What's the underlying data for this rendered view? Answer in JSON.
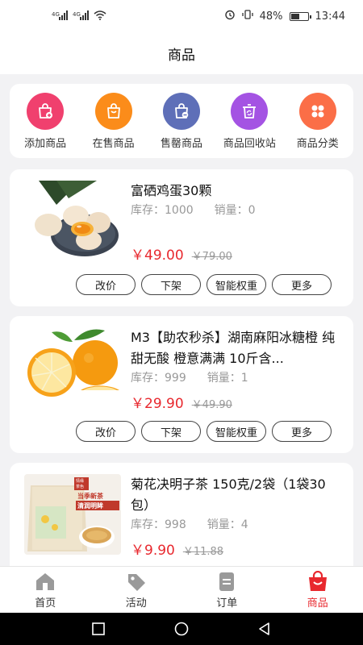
{
  "status_bar": {
    "signal1": "⁴ᴳ",
    "signal2": "⁴ᴳ",
    "battery_pct": "48%",
    "time": "13:44"
  },
  "header": {
    "title": "商品"
  },
  "categories": [
    {
      "label": "添加商品",
      "icon": "bag-plus-icon",
      "color": "#f0406e"
    },
    {
      "label": "在售商品",
      "icon": "bag-icon",
      "color": "#fb8c1a"
    },
    {
      "label": "售罄商品",
      "icon": "bag-soldout-icon",
      "color": "#5e6fb8"
    },
    {
      "label": "商品回收站",
      "icon": "recycle-icon",
      "color": "#a453e3"
    },
    {
      "label": "商品分类",
      "icon": "category-icon",
      "color": "#fb6e47"
    }
  ],
  "products": [
    {
      "title": "富硒鸡蛋30颗",
      "stock_label": "库存：1000",
      "sales_label": "销量：0",
      "price": "￥49.00",
      "old_price": "￥79.00",
      "image": "eggs-image"
    },
    {
      "title": "M3【助农秒杀】湖南麻阳冰糖橙 纯甜无酸 橙意满满 10斤含...",
      "stock_label": "库存：999",
      "sales_label": "销量：1",
      "price": "￥29.90",
      "old_price": "￥49.90",
      "image": "oranges-image"
    },
    {
      "title": "菊花决明子茶 150克/2袋（1袋30包）",
      "stock_label": "库存：998",
      "sales_label": "销量：4",
      "price": "￥9.90",
      "old_price": "￥11.88",
      "image": "tea-image",
      "image_text": [
        "情缘",
        "茶色",
        "当季新茶",
        "清润明眸"
      ]
    }
  ],
  "actions": {
    "reprice": "改价",
    "delist": "下架",
    "weight": "智能权重",
    "more": "更多"
  },
  "tabs": [
    {
      "label": "首页",
      "icon": "home-icon"
    },
    {
      "label": "活动",
      "icon": "tag-icon"
    },
    {
      "label": "订单",
      "icon": "order-icon"
    },
    {
      "label": "商品",
      "icon": "shop-bag-icon",
      "active": true
    }
  ]
}
